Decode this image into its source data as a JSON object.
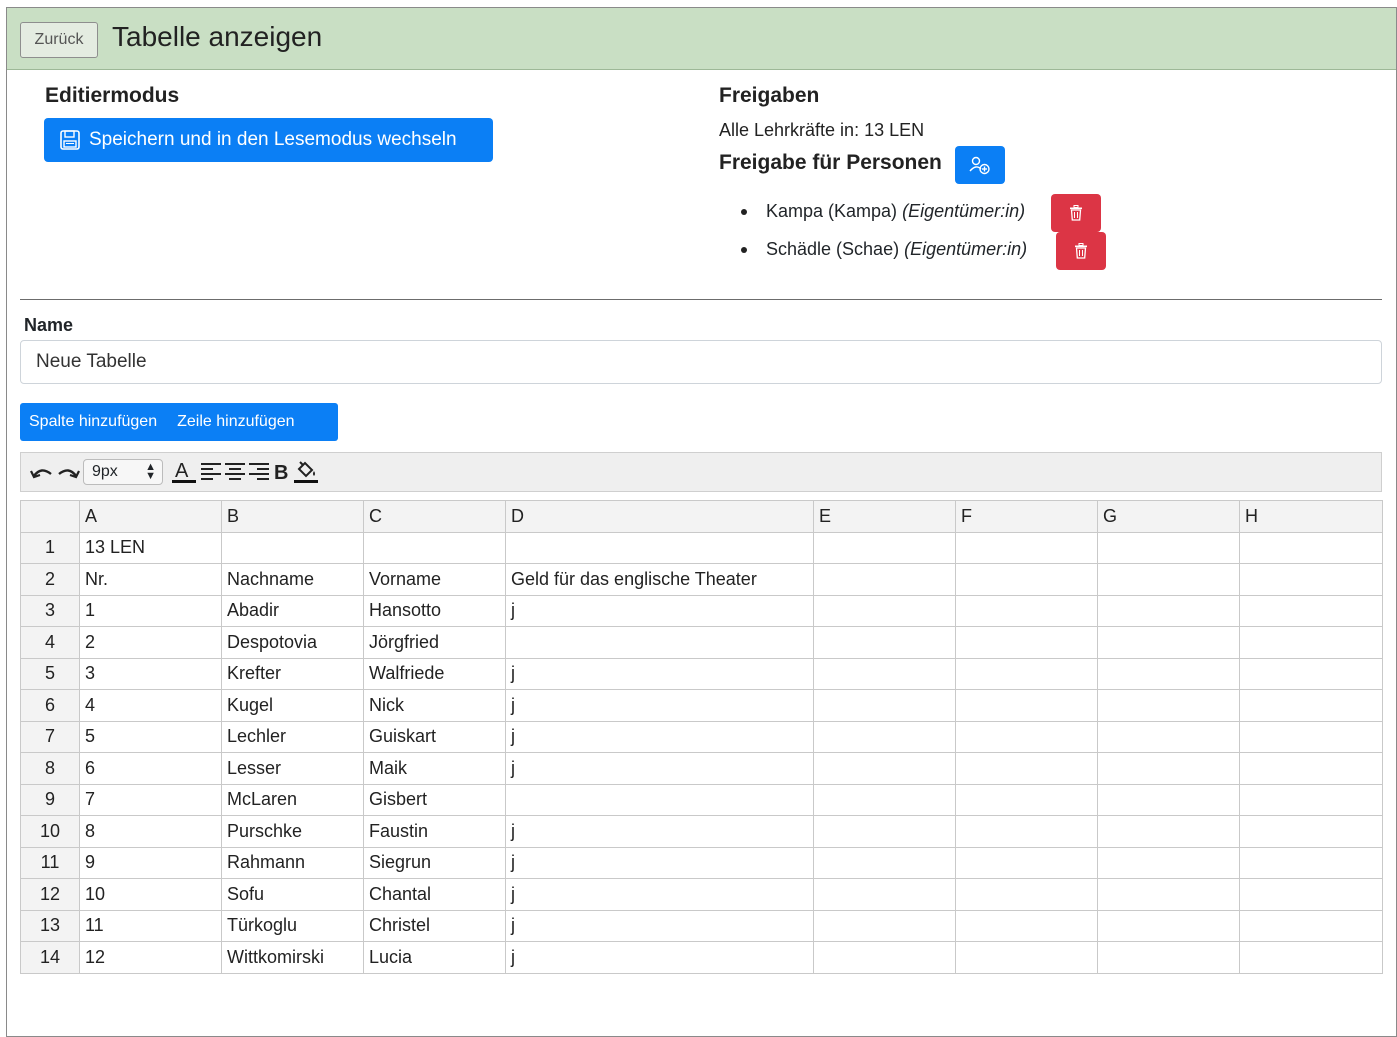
{
  "header": {
    "back_label": "Zurück",
    "title": "Tabelle anzeigen",
    "bg_color": "#c9dfc4"
  },
  "edit": {
    "heading": "Editiermodus",
    "save_label": "Speichern und in den Lesemodus wechseln"
  },
  "shares": {
    "heading": "Freigaben",
    "all_teachers": "Alle Lehrkräfte in: 13 LEN",
    "persons_heading": "Freigabe für Personen",
    "people": [
      {
        "name": "Kampa (Kampa)",
        "role": "(Eigentümer:in)"
      },
      {
        "name": "Schädle (Schae)",
        "role": "(Eigentümer:in)"
      }
    ]
  },
  "name_field": {
    "label": "Name",
    "value": "Neue Tabelle"
  },
  "actions": {
    "add_column": "Spalte hinzufügen",
    "add_row": "Zeile hinzufügen"
  },
  "toolbar": {
    "font_size": "9px",
    "icons": [
      "undo-icon",
      "redo-icon",
      "text-color-icon",
      "align-left-icon",
      "align-center-icon",
      "align-right-icon",
      "bold-icon",
      "fill-color-icon"
    ]
  },
  "colors": {
    "primary": "#0b7ff5",
    "danger": "#dc3545"
  },
  "sheet": {
    "columns": [
      "A",
      "B",
      "C",
      "D",
      "E",
      "F",
      "G",
      "H"
    ],
    "rows": [
      {
        "n": "1",
        "cells": [
          "13 LEN",
          "",
          "",
          "",
          "",
          "",
          "",
          ""
        ]
      },
      {
        "n": "2",
        "cells": [
          "Nr.",
          "Nachname",
          "Vorname",
          "Geld für das englische Theater",
          "",
          "",
          "",
          ""
        ]
      },
      {
        "n": "3",
        "cells": [
          "1",
          "Abadir",
          "Hansotto",
          "j",
          "",
          "",
          "",
          ""
        ]
      },
      {
        "n": "4",
        "cells": [
          "2",
          "Despotovia",
          "Jörgfried",
          "",
          "",
          "",
          "",
          ""
        ]
      },
      {
        "n": "5",
        "cells": [
          "3",
          "Krefter",
          "Walfriede",
          "j",
          "",
          "",
          "",
          ""
        ]
      },
      {
        "n": "6",
        "cells": [
          "4",
          "Kugel",
          "Nick",
          "j",
          "",
          "",
          "",
          ""
        ]
      },
      {
        "n": "7",
        "cells": [
          "5",
          "Lechler",
          "Guiskart",
          "j",
          "",
          "",
          "",
          ""
        ]
      },
      {
        "n": "8",
        "cells": [
          "6",
          "Lesser",
          "Maik",
          "j",
          "",
          "",
          "",
          ""
        ]
      },
      {
        "n": "9",
        "cells": [
          "7",
          "McLaren",
          "Gisbert",
          "",
          "",
          "",
          "",
          ""
        ]
      },
      {
        "n": "10",
        "cells": [
          "8",
          "Purschke",
          "Faustin",
          "j",
          "",
          "",
          "",
          ""
        ]
      },
      {
        "n": "11",
        "cells": [
          "9",
          "Rahmann",
          "Siegrun",
          "j",
          "",
          "",
          "",
          ""
        ]
      },
      {
        "n": "12",
        "cells": [
          "10",
          "Sofu",
          "Chantal",
          "j",
          "",
          "",
          "",
          ""
        ]
      },
      {
        "n": "13",
        "cells": [
          "11",
          "Türkoglu",
          "Christel",
          "j",
          "",
          "",
          "",
          ""
        ]
      },
      {
        "n": "14",
        "cells": [
          "12",
          "Wittkomirski",
          "Lucia",
          "j",
          "",
          "",
          "",
          ""
        ]
      }
    ]
  }
}
